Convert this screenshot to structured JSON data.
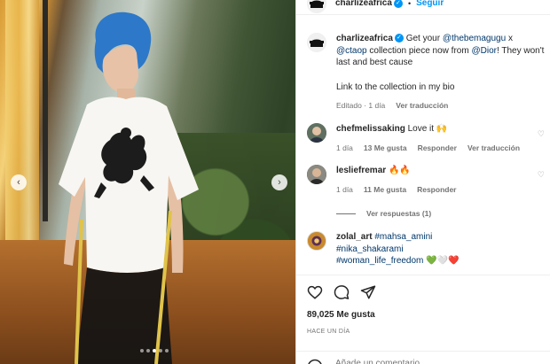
{
  "header": {
    "username": "charlizeafrica",
    "separator": "•",
    "follow_label": "Seguir",
    "verified_icon": "verified-badge-icon"
  },
  "caption": {
    "username": "charlizeafrica",
    "segments": [
      {
        "text": "Get your ",
        "type": "text"
      },
      {
        "text": "@thebemagugu",
        "type": "mention"
      },
      {
        "text": " x ",
        "type": "text"
      },
      {
        "text": "@ctaop",
        "type": "mention"
      },
      {
        "text": " collection piece now from ",
        "type": "text"
      },
      {
        "text": "@Dior",
        "type": "mention"
      },
      {
        "text": "! They won't last and best cause",
        "type": "text"
      }
    ],
    "line2": "Link to the collection in my bio",
    "edited": "Editado · 1 día",
    "translate": "Ver traducción"
  },
  "comments": [
    {
      "username": "chefmelissaking",
      "text": "Love it 🙌",
      "time": "1 día",
      "likes": "13 Me gusta",
      "reply": "Responder",
      "translate": "Ver traducción"
    },
    {
      "username": "lesliefremar",
      "text": "🔥🔥",
      "time": "1 día",
      "likes": "11 Me gusta",
      "reply": "Responder",
      "view_replies": "Ver respuestas (1)"
    },
    {
      "username": "zolal_art",
      "hashtags": [
        "#mahsa_amini",
        "#nika_shakarami",
        "#woman_life_freedom"
      ],
      "emoji": "💚🤍❤️"
    }
  ],
  "actions": {
    "likes": "89,025 Me gusta",
    "when": "HACE UN DÍA",
    "add_comment_placeholder": "Añade un comentario..."
  },
  "colors": {
    "accent": "#0095f6",
    "mention": "#00376b",
    "muted": "#737373"
  }
}
